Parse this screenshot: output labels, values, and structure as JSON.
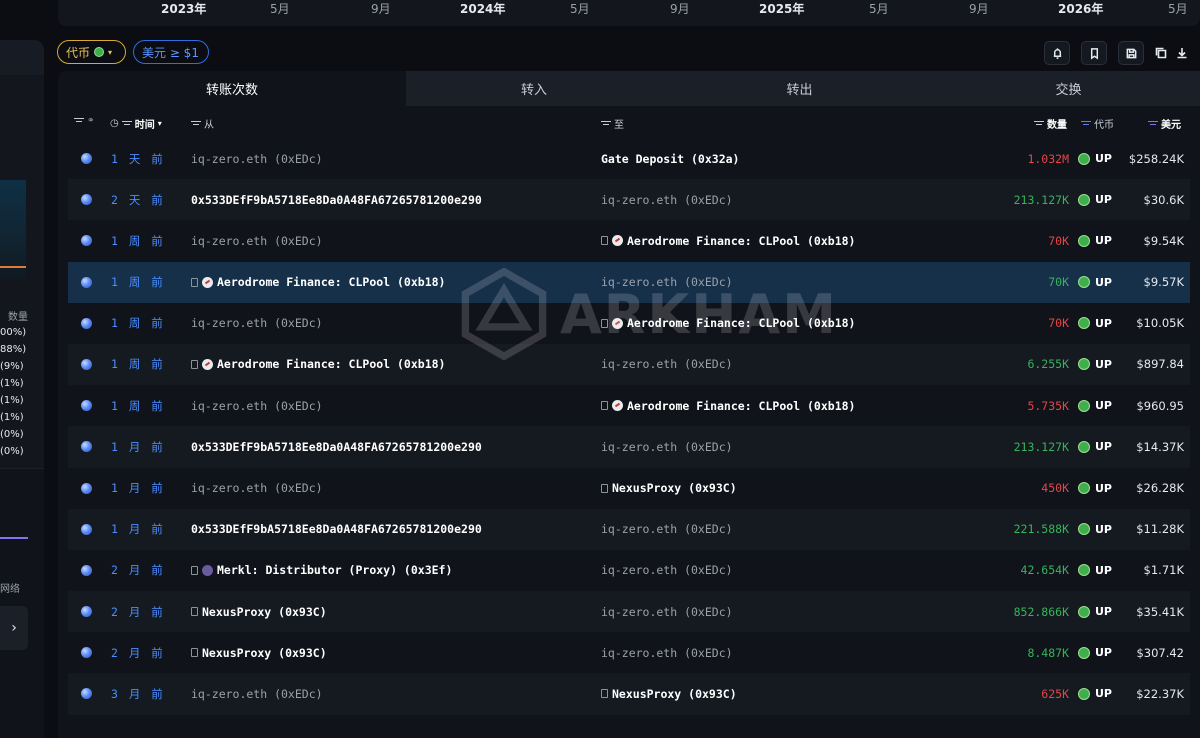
{
  "timeline": {
    "ticks": [
      "2023年",
      "5月",
      "9月",
      "2024年",
      "5月",
      "9月",
      "2025年",
      "5月",
      "9月",
      "2026年",
      "5月"
    ]
  },
  "left_panel": {
    "quantity_label": "数量",
    "percents": [
      "00%)",
      "88%)",
      "(9%)",
      "(1%)",
      "(1%)",
      "(1%)",
      "(0%)",
      "(0%)"
    ],
    "network_label": "网络",
    "arrow": "›"
  },
  "filters": {
    "token_chip": "代币",
    "usd_chip": "美元 ≥ $1"
  },
  "tabs": [
    "转账次数",
    "转入",
    "转出",
    "交换"
  ],
  "columns": {
    "time": "时间",
    "from": "从",
    "to": "至",
    "quantity": "数量",
    "token": "代币",
    "usd": "美元"
  },
  "rows": [
    {
      "time": "1 天 前",
      "from": "iq-zero.eth (0xEDc)",
      "from_style": "gray",
      "from_icon": "",
      "to": "Gate Deposit (0x32a)",
      "to_style": "bold",
      "to_icon": "",
      "amount": "1.032M",
      "dir": "out",
      "token": "UP",
      "usd": "$258.24K"
    },
    {
      "time": "2 天 前",
      "from": "0x533DEfF9bA5718Ee8Da0A48FA67265781200e290",
      "from_style": "bold",
      "from_icon": "",
      "to": "iq-zero.eth (0xEDc)",
      "to_style": "gray",
      "to_icon": "",
      "amount": "213.127K",
      "dir": "in",
      "token": "UP",
      "usd": "$30.6K"
    },
    {
      "time": "1 周 前",
      "from": "iq-zero.eth (0xEDc)",
      "from_style": "gray",
      "from_icon": "",
      "to": "Aerodrome Finance: CLPool (0xb18)",
      "to_style": "bold",
      "to_icon": "aero",
      "amount": "70K",
      "dir": "out",
      "token": "UP",
      "usd": "$9.54K"
    },
    {
      "time": "1 周 前",
      "from": "Aerodrome Finance: CLPool (0xb18)",
      "from_style": "bold",
      "from_icon": "aero",
      "to": "iq-zero.eth (0xEDc)",
      "to_style": "gray",
      "to_icon": "",
      "amount": "70K",
      "dir": "in",
      "token": "UP",
      "usd": "$9.57K"
    },
    {
      "time": "1 周 前",
      "from": "iq-zero.eth (0xEDc)",
      "from_style": "gray",
      "from_icon": "",
      "to": "Aerodrome Finance: CLPool (0xb18)",
      "to_style": "bold",
      "to_icon": "aero",
      "amount": "70K",
      "dir": "out",
      "token": "UP",
      "usd": "$10.05K"
    },
    {
      "time": "1 周 前",
      "from": "Aerodrome Finance: CLPool (0xb18)",
      "from_style": "bold",
      "from_icon": "aero",
      "to": "iq-zero.eth (0xEDc)",
      "to_style": "gray",
      "to_icon": "",
      "amount": "6.255K",
      "dir": "in",
      "token": "UP",
      "usd": "$897.84"
    },
    {
      "time": "1 周 前",
      "from": "iq-zero.eth (0xEDc)",
      "from_style": "gray",
      "from_icon": "",
      "to": "Aerodrome Finance: CLPool (0xb18)",
      "to_style": "bold",
      "to_icon": "aero",
      "amount": "5.735K",
      "dir": "out",
      "token": "UP",
      "usd": "$960.95"
    },
    {
      "time": "1 月 前",
      "from": "0x533DEfF9bA5718Ee8Da0A48FA67265781200e290",
      "from_style": "bold",
      "from_icon": "",
      "to": "iq-zero.eth (0xEDc)",
      "to_style": "gray",
      "to_icon": "",
      "amount": "213.127K",
      "dir": "in",
      "token": "UP",
      "usd": "$14.37K"
    },
    {
      "time": "1 月 前",
      "from": "iq-zero.eth (0xEDc)",
      "from_style": "gray",
      "from_icon": "",
      "to": "NexusProxy (0x93C)",
      "to_style": "bold",
      "to_icon": "doc",
      "amount": "450K",
      "dir": "out",
      "token": "UP",
      "usd": "$26.28K"
    },
    {
      "time": "1 月 前",
      "from": "0x533DEfF9bA5718Ee8Da0A48FA67265781200e290",
      "from_style": "bold",
      "from_icon": "",
      "to": "iq-zero.eth (0xEDc)",
      "to_style": "gray",
      "to_icon": "",
      "amount": "221.588K",
      "dir": "in",
      "token": "UP",
      "usd": "$11.28K"
    },
    {
      "time": "2 月 前",
      "from": "Merkl: Distributor (Proxy) (0x3Ef)",
      "from_style": "bold",
      "from_icon": "merkl",
      "to": "iq-zero.eth (0xEDc)",
      "to_style": "gray",
      "to_icon": "",
      "amount": "42.654K",
      "dir": "in",
      "token": "UP",
      "usd": "$1.71K"
    },
    {
      "time": "2 月 前",
      "from": "NexusProxy (0x93C)",
      "from_style": "bold",
      "from_icon": "doc",
      "to": "iq-zero.eth (0xEDc)",
      "to_style": "gray",
      "to_icon": "",
      "amount": "852.866K",
      "dir": "in",
      "token": "UP",
      "usd": "$35.41K"
    },
    {
      "time": "2 月 前",
      "from": "NexusProxy (0x93C)",
      "from_style": "bold",
      "from_icon": "doc",
      "to": "iq-zero.eth (0xEDc)",
      "to_style": "gray",
      "to_icon": "",
      "amount": "8.487K",
      "dir": "in",
      "token": "UP",
      "usd": "$307.42"
    },
    {
      "time": "3 月 前",
      "from": "iq-zero.eth (0xEDc)",
      "from_style": "gray",
      "from_icon": "",
      "to": "NexusProxy (0x93C)",
      "to_style": "bold",
      "to_icon": "doc",
      "amount": "625K",
      "dir": "out",
      "token": "UP",
      "usd": "$22.37K"
    }
  ],
  "highlighted_row": 3,
  "watermark": "ARKHAM",
  "colors": {
    "in": "#36b35a",
    "out": "#e04848",
    "time_link": "#4a8dff",
    "token_chip": "#d6a932",
    "usd_chip": "#2f6ee0",
    "highlight": "#16304a"
  }
}
